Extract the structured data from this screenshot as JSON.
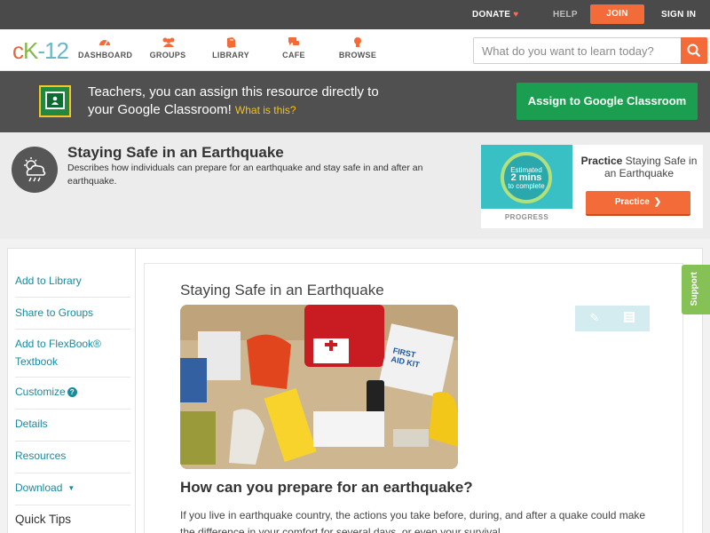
{
  "topbar": {
    "donate": "DONATE",
    "help": "HELP",
    "join": "JOIN",
    "signin": "SIGN IN"
  },
  "nav": {
    "logo": {
      "c": "c",
      "k": "K",
      "n": "-12"
    },
    "items": [
      "DASHBOARD",
      "GROUPS",
      "LIBRARY",
      "CAFE",
      "BROWSE"
    ],
    "search_placeholder": "What do you want to learn today?"
  },
  "banner": {
    "text": "Teachers, you can assign this resource directly to your Google Classroom!",
    "what": "What is this?",
    "button": "Assign to Google Classroom"
  },
  "concept": {
    "title": "Staying Safe in an Earthquake",
    "description": "Describes how individuals can prepare for an earthquake and stay safe in and after an earthquake."
  },
  "practice": {
    "estimated": "Estimated",
    "minutes": "2 mins",
    "to_complete": "to complete",
    "progress_label": "PROGRESS",
    "heading_bold": "Practice",
    "heading_rest": "Staying Safe in an Earthquake",
    "button": "Practice"
  },
  "sidebar": {
    "items": [
      "Add to Library",
      "Share to Groups",
      "Add to FlexBook® Textbook",
      "Customize",
      "Details",
      "Resources",
      "Download",
      "Quick Tips"
    ]
  },
  "article": {
    "title": "Staying Safe in an Earthquake",
    "heading": "How can you prepare for an earthquake?",
    "paragraph": "If you live in earthquake country, the actions you take before, during, and after a quake could make the difference in your comfort for several days, or even your survival."
  },
  "support": "Support",
  "colors": {
    "accent_orange": "#f26b38",
    "google_green": "#1b9e4f",
    "link_teal": "#1a8a9e",
    "support_green": "#86c155"
  }
}
